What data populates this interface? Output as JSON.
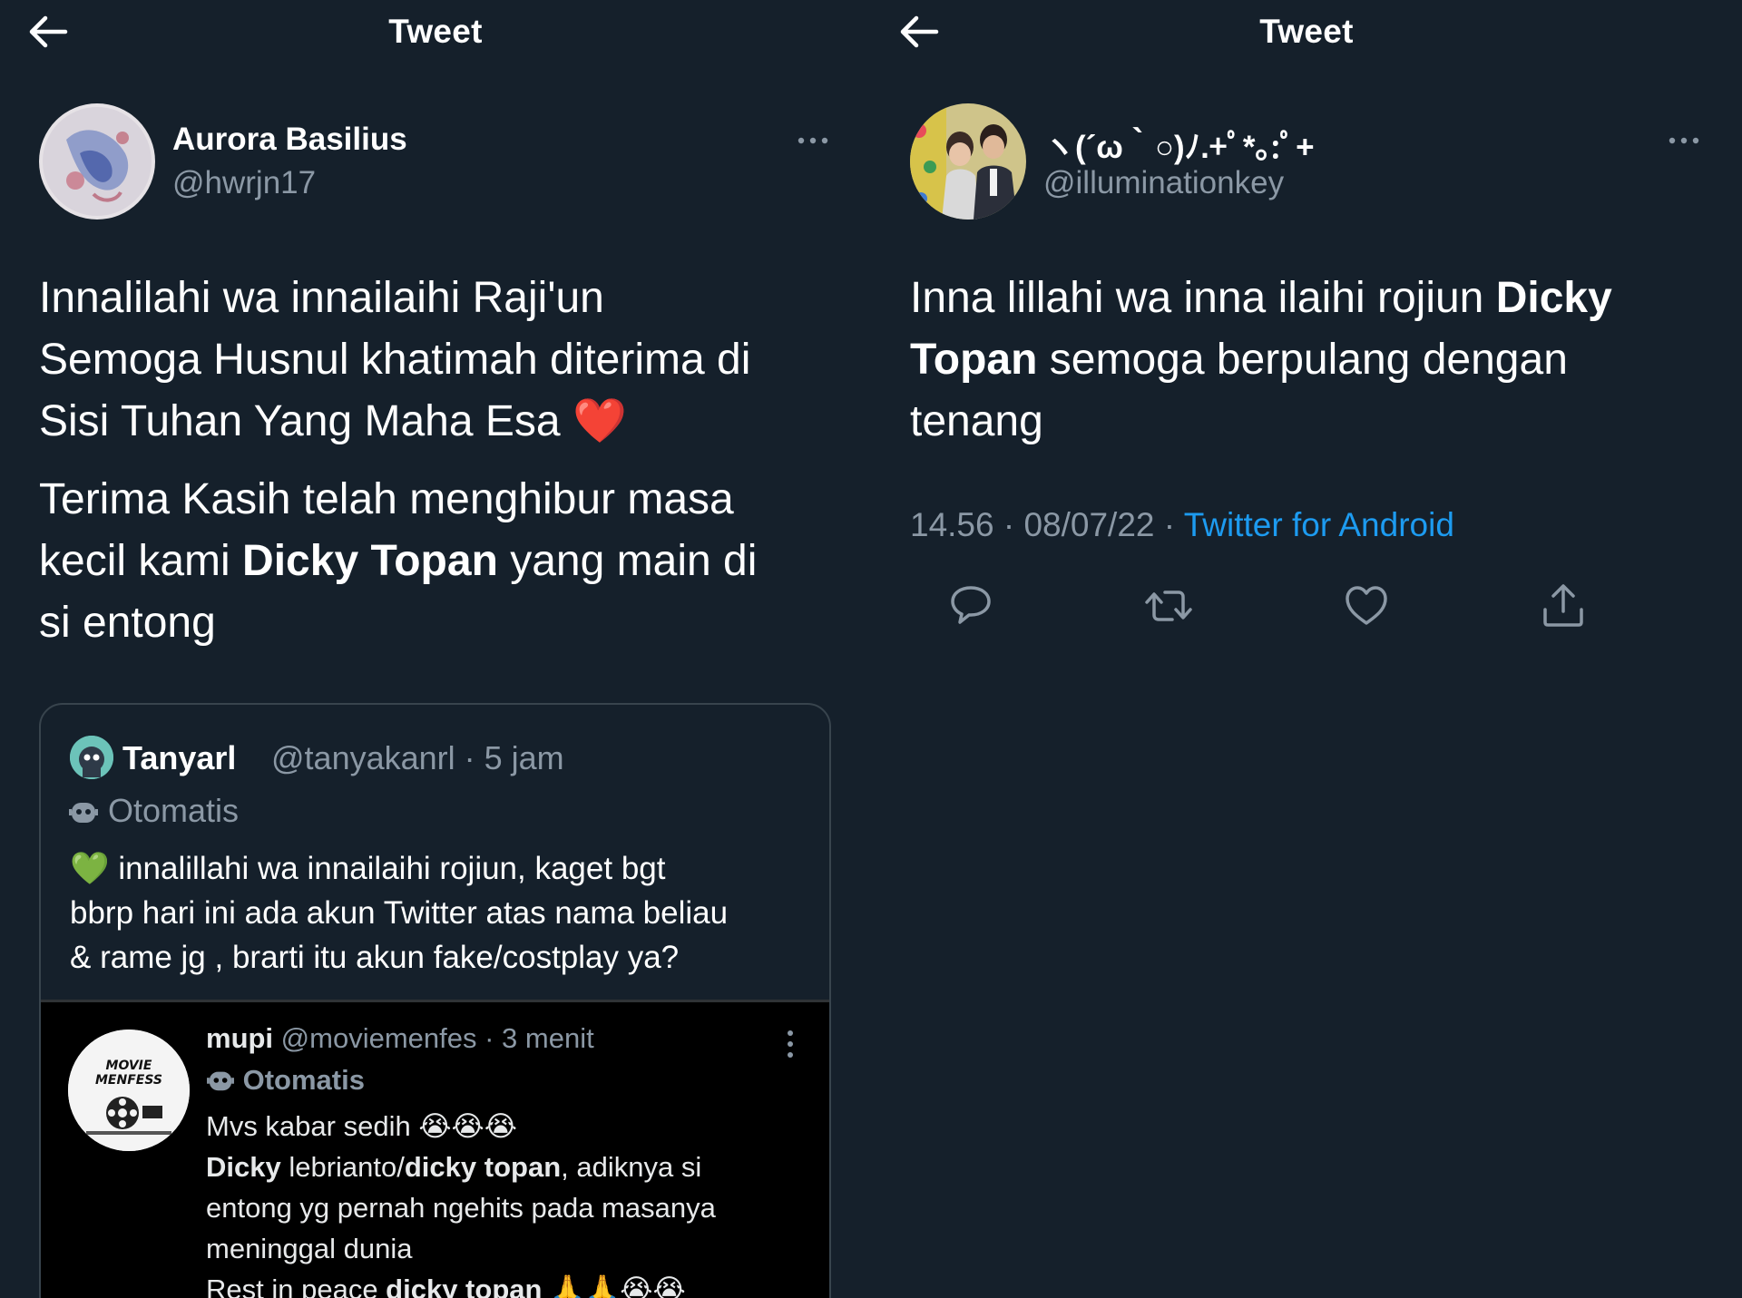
{
  "left": {
    "header": {
      "title": "Tweet"
    },
    "author": {
      "name": "Aurora Basilius",
      "handle": "@hwrjn17"
    },
    "tweet": {
      "p1_l1": "Innalilahi wa innailaihi Raji'un",
      "p1_l2": "Semoga Husnul khatimah diterima di",
      "p1_l3": "Sisi Tuhan Yang Maha Esa",
      "p1_emoji": "❤️",
      "p2_l1": "Terima Kasih telah menghibur masa",
      "p2_l2a": "kecil kami ",
      "p2_l2b": "Dicky Topan",
      "p2_l2c": " yang main di",
      "p2_l3": "si entong"
    },
    "quote": {
      "name": "Tanyarl",
      "handle_time": "@tanyakanrl · 5 jam",
      "automated": "Otomatis",
      "body_emoji": "💚",
      "body_l1": " innalillahi wa innailaihi rojiun, kaget bgt",
      "body_l2": "bbrp hari ini ada akun Twitter atas nama beliau",
      "body_l3": "& rame jg , brarti itu akun fake/costplay ya?"
    },
    "screenshot": {
      "name": "mupi",
      "handle_time": " @moviemenfes · 3 menit",
      "automated": "Otomatis",
      "avatar_text": "MOVIE MENFESS",
      "l1": "Mvs kabar sedih 😭😭😭",
      "l2a": "Dicky",
      "l2b": " lebrianto/",
      "l2c": "dicky topan",
      "l2d": ", adiknya si",
      "l3": "entong yg pernah ngehits pada masanya",
      "l4": "meninggal dunia",
      "l5a": "Rest in peace ",
      "l5b": "dicky topan",
      "l5c": " 🙏🙏😭😭"
    }
  },
  "right": {
    "header": {
      "title": "Tweet"
    },
    "author": {
      "name": "ヽ(´ω｀○)ﾉ.+ﾟ*｡:ﾟ+",
      "handle": "@illuminationkey"
    },
    "tweet": {
      "l1a": "Inna lillahi wa inna ilaihi rojiun ",
      "l1b": "Dicky",
      "l2a": "Topan",
      "l2b": " semoga berpulang dengan",
      "l3": "tenang"
    },
    "meta": {
      "time_date": "14.56 · 08/07/22 · ",
      "source": "Twitter for Android"
    }
  },
  "colors": {
    "background": "#15202b",
    "secondary_text": "#8b98a5",
    "link": "#1d9bf0",
    "border": "#38444d"
  },
  "icons": [
    "back-arrow-icon",
    "more-icon",
    "bot-icon",
    "reply-icon",
    "retweet-icon",
    "like-icon",
    "share-icon",
    "kebab-icon"
  ]
}
